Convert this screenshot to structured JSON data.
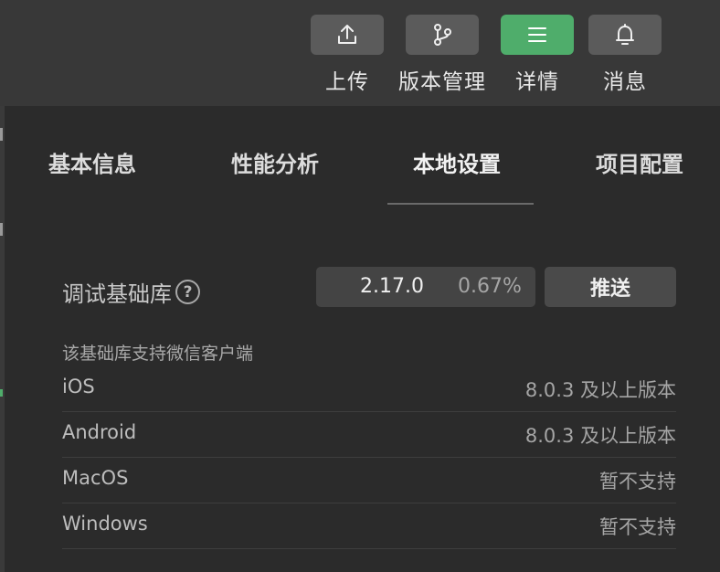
{
  "toolbar": {
    "buttons": [
      {
        "label": "上传",
        "icon": "upload-icon"
      },
      {
        "label": "版本管理",
        "icon": "branch-icon"
      },
      {
        "label": "详情",
        "icon": "menu-icon",
        "active": true
      },
      {
        "label": "消息",
        "icon": "bell-icon"
      }
    ],
    "active_color": "#4fad6b"
  },
  "tabs": [
    {
      "label": "基本信息"
    },
    {
      "label": "性能分析"
    },
    {
      "label": "本地设置",
      "active": true
    },
    {
      "label": "项目配置"
    }
  ],
  "debug_lib": {
    "label": "调试基础库",
    "help_glyph": "?",
    "version": "2.17.0",
    "percent": "0.67%",
    "push_label": "推送"
  },
  "support": {
    "title": "该基础库支持微信客户端",
    "rows": [
      {
        "os": "iOS",
        "requirement": "8.0.3 及以上版本"
      },
      {
        "os": "Android",
        "requirement": "8.0.3 及以上版本"
      },
      {
        "os": "MacOS",
        "requirement": "暂不支持"
      },
      {
        "os": "Windows",
        "requirement": "暂不支持"
      }
    ]
  }
}
